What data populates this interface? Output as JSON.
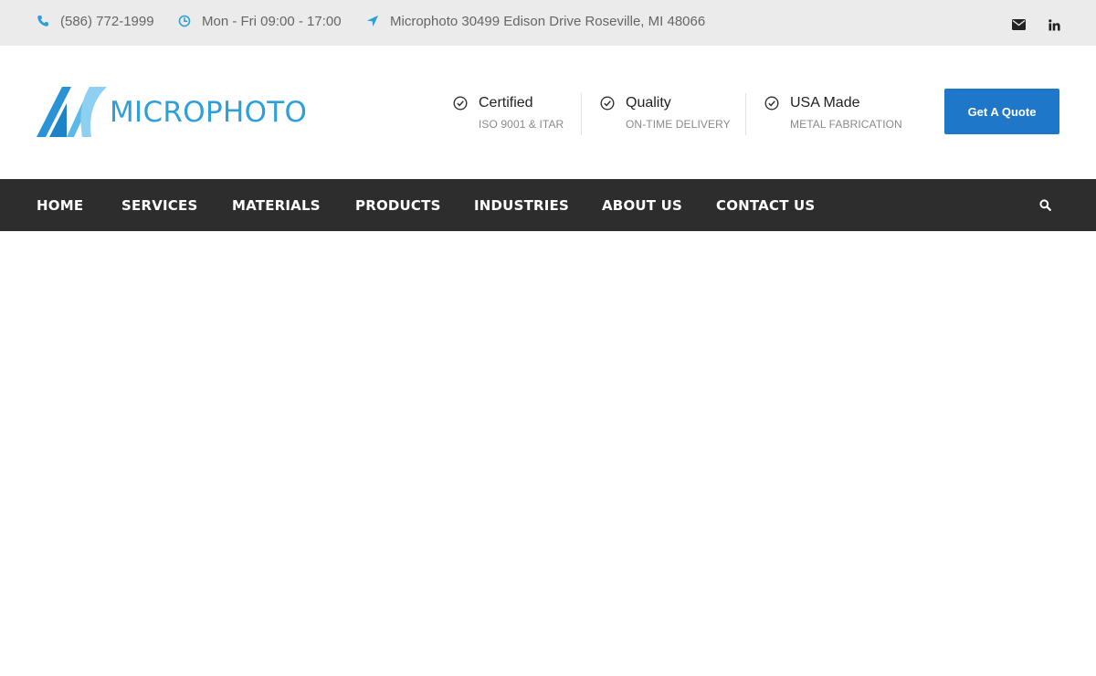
{
  "topbar": {
    "phone": "(586) 772-1999",
    "hours": "Mon - Fri 09:00 - 17:00",
    "address": "Microphoto 30499 Edison Drive Roseville, MI 48066",
    "icons": {
      "phone": "phone-icon",
      "hours": "clock-icon",
      "address": "location-arrow-icon",
      "email": "envelope-icon",
      "linkedin": "linkedin-icon"
    }
  },
  "header": {
    "logo_text": "MICROPHOTO",
    "features": [
      {
        "title": "Certified",
        "subtitle": "ISO 9001 & ITAR"
      },
      {
        "title": "Quality",
        "subtitle": "ON-TIME DELIVERY"
      },
      {
        "title": "USA Made",
        "subtitle": "METAL FABRICATION"
      }
    ],
    "cta_label": "Get A Quote"
  },
  "nav": {
    "items": [
      {
        "label": "HOME"
      },
      {
        "label": "SERVICES"
      },
      {
        "label": "MATERIALS"
      },
      {
        "label": "PRODUCTS"
      },
      {
        "label": "INDUSTRIES"
      },
      {
        "label": "ABOUT US"
      },
      {
        "label": "CONTACT US"
      }
    ],
    "search_icon": "search-icon"
  },
  "colors": {
    "accent": "#2e9fd9",
    "button": "#1f77c9",
    "nav_bg": "#2d2d2d",
    "topbar_bg": "#ebebeb"
  }
}
